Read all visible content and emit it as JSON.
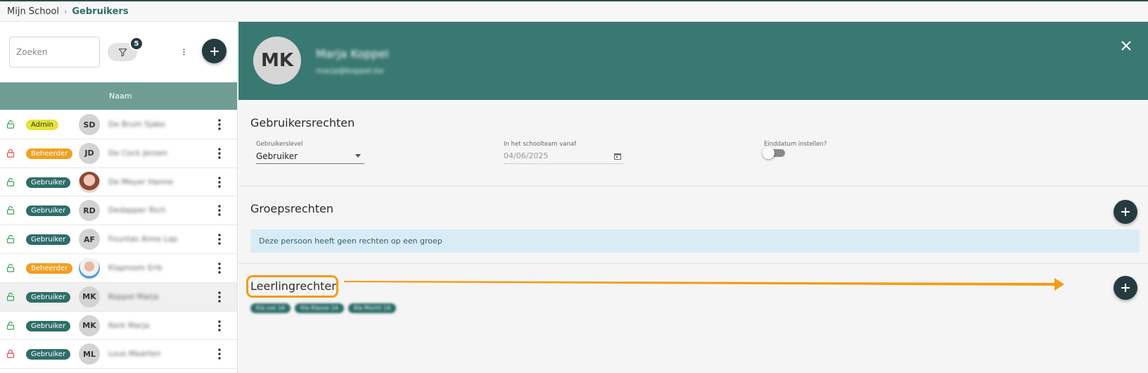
{
  "breadcrumb": {
    "root": "Mijn School",
    "current": "Gebruikers"
  },
  "search": {
    "placeholder": "Zoeken"
  },
  "filter": {
    "count": "5"
  },
  "table": {
    "header_name": "Naam"
  },
  "users": [
    {
      "role": "Admin",
      "role_type": "admin",
      "initials": "SD",
      "name": "De Bruin Sjako",
      "locked": false
    },
    {
      "role": "Beheerder",
      "role_type": "beheerder",
      "initials": "JD",
      "name": "De Cock Jeroen",
      "locked": true
    },
    {
      "role": "Gebruiker",
      "role_type": "gebruiker",
      "initials": "",
      "name": "De Meyer Hanne",
      "locked": false
    },
    {
      "role": "Gebruiker",
      "role_type": "gebruiker",
      "initials": "RD",
      "name": "Dedapper Rich",
      "locked": false
    },
    {
      "role": "Gebruiker",
      "role_type": "gebruiker",
      "initials": "AF",
      "name": "Fountas Anne Lap",
      "locked": false
    },
    {
      "role": "Beheerder",
      "role_type": "beheerder",
      "initials": "",
      "name": "Klaproom Erik",
      "locked": false
    },
    {
      "role": "Gebruiker",
      "role_type": "gebruiker",
      "initials": "MK",
      "name": "Koppel Marja",
      "locked": false
    },
    {
      "role": "Gebruiker",
      "role_type": "gebruiker",
      "initials": "MK",
      "name": "Kerk Marja",
      "locked": false
    },
    {
      "role": "Gebruiker",
      "role_type": "gebruiker",
      "initials": "ML",
      "name": "Lous Maarten",
      "locked": true
    }
  ],
  "profile": {
    "initials": "MK",
    "name": "Marja Koppel",
    "email": "marja@koppel.be"
  },
  "rights": {
    "title": "Gebruikersrechten",
    "level_label": "Gebruikerslevel",
    "level_value": "Gebruiker",
    "team_label": "In het schoolteam vanaf",
    "team_value": "04/06/2025",
    "end_label": "Einddatum instellen?"
  },
  "groups": {
    "title": "Groepsrechten",
    "empty_message": "Deze persoon heeft geen rechten op een groep"
  },
  "students": {
    "title": "Leerlingrechten",
    "chips": [
      "Kla sse 1A",
      "Kla Klasse 1A",
      "Kla Mocht 1A"
    ]
  },
  "colors": {
    "header": "#3a7872",
    "accent": "#2e6e69",
    "fab": "#263b40",
    "highlight": "#f39c12",
    "admin": "#e4e43a",
    "beheerder": "#f0a020"
  },
  "icons": {
    "lock_open": "lock-open-icon",
    "lock_closed": "lock-closed-icon",
    "filter": "filter-icon",
    "plus": "plus-icon",
    "close": "close-icon",
    "calendar": "calendar-icon",
    "kebab": "more-vertical-icon"
  }
}
